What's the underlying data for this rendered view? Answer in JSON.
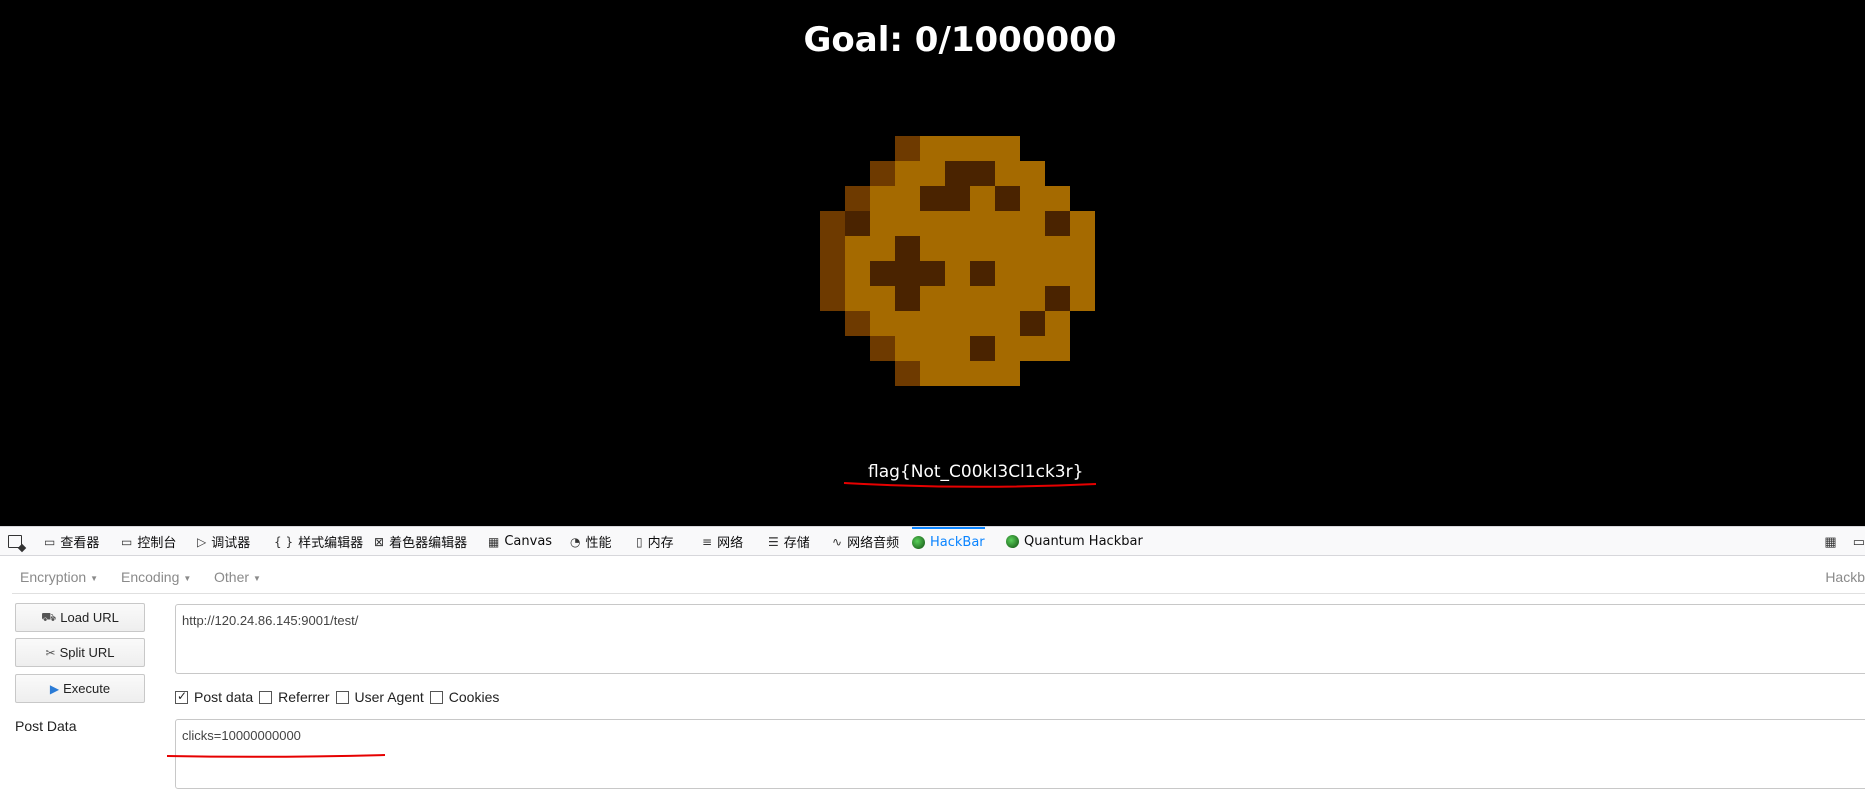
{
  "page": {
    "goal_text": "Goal: 0/1000000",
    "flag_text": "flag{Not_C00kI3Cl1ck3r}",
    "cookie_pixels": [
      "..........................",
      "....MMM...................",
      "....................",
      "..........................",
      "..........................",
      "..........................",
      "..........................",
      "..........................",
      "..........................",
      ".........................."
    ]
  },
  "devtools": {
    "tabs": [
      {
        "icon": "▭",
        "label": "查看器"
      },
      {
        "icon": "▭",
        "label": "控制台"
      },
      {
        "icon": "▷",
        "label": "调试器"
      },
      {
        "icon": "{ }",
        "label": "样式编辑器"
      },
      {
        "icon": "⊠",
        "label": "着色器编辑器"
      },
      {
        "icon": "▦",
        "label": "Canvas"
      },
      {
        "icon": "◔",
        "label": "性能"
      },
      {
        "icon": "▯",
        "label": "内存"
      },
      {
        "icon": "≡",
        "label": "网络"
      },
      {
        "icon": "☰",
        "label": "存储"
      },
      {
        "icon": "∿",
        "label": "网络音频"
      },
      {
        "icon": "",
        "label": "HackBar"
      },
      {
        "icon": "",
        "label": "Quantum Hackbar"
      }
    ],
    "active_tab": "HackBar"
  },
  "hackbar": {
    "menu": [
      "Encryption",
      "Encoding",
      "Other"
    ],
    "right_label": "Hackb",
    "buttons": {
      "load_url": "Load URL",
      "split_url": "Split URL",
      "execute": "Execute"
    },
    "post_data_label": "Post Data",
    "url_value": "http://120.24.86.145:9001/test/",
    "checkboxes": {
      "post_data": {
        "label": "Post data",
        "checked": true
      },
      "referrer": {
        "label": "Referrer",
        "checked": false
      },
      "user_agent": {
        "label": "User Agent",
        "checked": false
      },
      "cookies": {
        "label": "Cookies",
        "checked": false
      }
    },
    "post_value": "clicks=10000000000"
  },
  "colors": {
    "annotation_red": "#e60000",
    "cookie_main": "#a56a00",
    "cookie_dark": "#4a2300",
    "cookie_edge": "#6e3a00",
    "active_tab": "#0a84ff"
  }
}
